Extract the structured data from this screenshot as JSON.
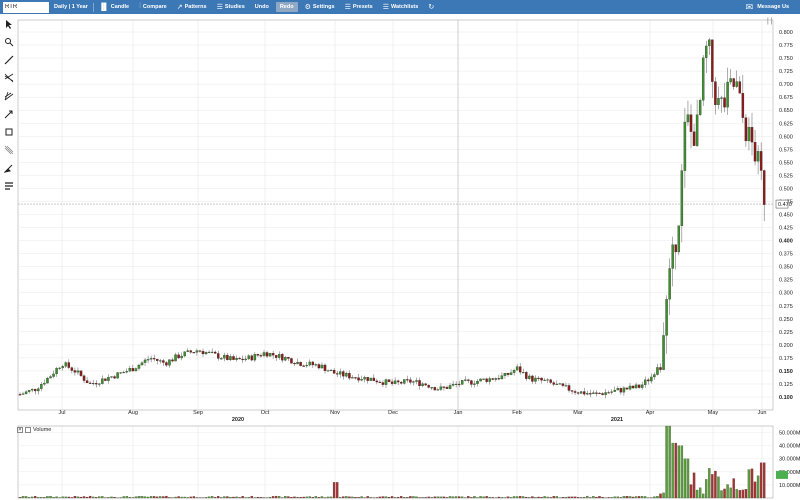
{
  "toolbar": {
    "symbol": "RTR",
    "interval": "Daily | 1 Year",
    "candle": "Candle",
    "compare": "Compare",
    "patterns": "Patterns",
    "studies": "Studies",
    "undo": "Undo",
    "redo": "Redo",
    "settings": "Settings",
    "presets": "Presets",
    "watchlists": "Watchlists",
    "message_us": "Message Us"
  },
  "colors": {
    "toolbar": "#3c78b5",
    "up": "#3e8e2f",
    "down": "#8b1a1a",
    "volume_up": "#5a9e3a",
    "volume_down": "#a83232"
  },
  "price_axis": {
    "ticks": [
      "0.800",
      "0.775",
      "0.750",
      "0.725",
      "0.700",
      "0.675",
      "0.650",
      "0.625",
      "0.600",
      "0.575",
      "0.550",
      "0.525",
      "0.500",
      "0.475",
      "0.450",
      "0.425",
      "0.400",
      "0.375",
      "0.350",
      "0.325",
      "0.300",
      "0.275",
      "0.250",
      "0.225",
      "0.200",
      "0.175",
      "0.150",
      "0.125",
      "0.100"
    ],
    "bold_ticks": [
      "0.400",
      "0.150",
      "0.100"
    ],
    "current_price": "0.470"
  },
  "date_axis": {
    "months": [
      "Jul",
      "Aug",
      "Sep",
      "Oct",
      "Nov",
      "Dec",
      "Jan",
      "Feb",
      "Mar",
      "Apr",
      "May",
      "Jun"
    ],
    "years": [
      "2020",
      "2021"
    ]
  },
  "volume": {
    "legend": "Volume",
    "ticks": [
      "50.000M",
      "40.000M",
      "30.000M",
      "20.000M",
      "10.000M"
    ],
    "current_label": ""
  },
  "chart_data": {
    "type": "candlestick",
    "symbol": "RTR",
    "period": "Daily | 1 Year",
    "ylim": [
      0.1,
      0.8
    ],
    "monthly_close": [
      {
        "month": "Jun 2020",
        "close": 0.105
      },
      {
        "month": "Jul 2020",
        "close": 0.13
      },
      {
        "month": "Aug 2020",
        "close": 0.155
      },
      {
        "month": "Sep 2020",
        "close": 0.18
      },
      {
        "month": "Oct 2020",
        "close": 0.17
      },
      {
        "month": "Nov 2020",
        "close": 0.14
      },
      {
        "month": "Dec 2020",
        "close": 0.12
      },
      {
        "month": "Jan 2021",
        "close": 0.135
      },
      {
        "month": "Feb 2021",
        "close": 0.135
      },
      {
        "month": "Mar 2021",
        "close": 0.105
      },
      {
        "month": "Apr 2021",
        "close": 0.5
      },
      {
        "month": "May 2021",
        "close": 0.65
      },
      {
        "month": "Jun 2021",
        "close": 0.47
      }
    ],
    "volume_ylim": [
      0,
      55000000
    ]
  }
}
